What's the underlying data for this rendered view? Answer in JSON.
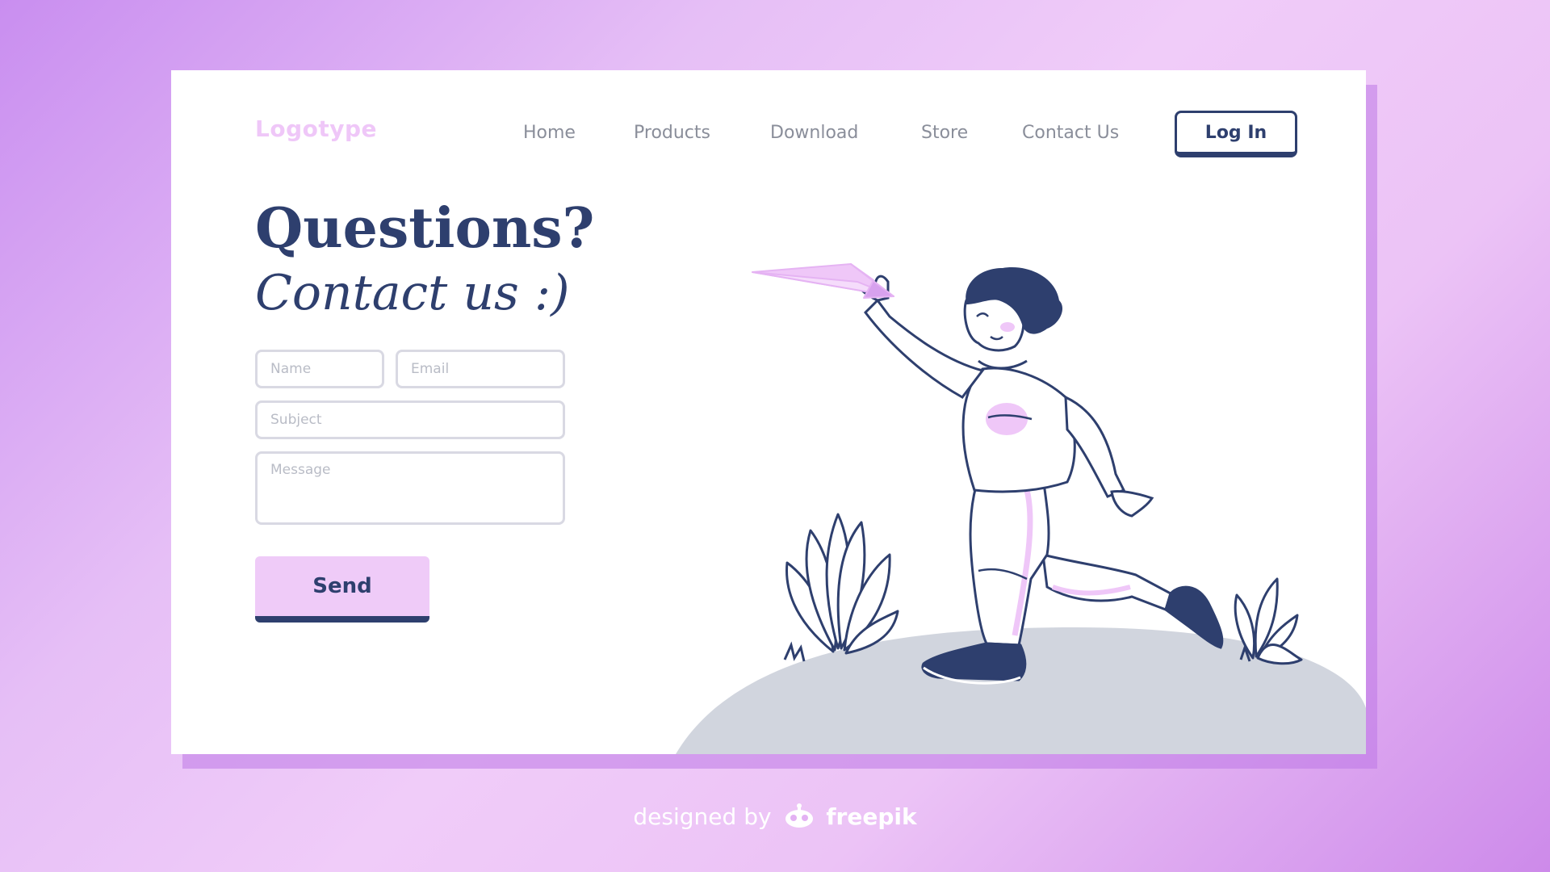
{
  "brand": {
    "logo_text": "Logotype"
  },
  "nav": {
    "items": [
      {
        "label": "Home"
      },
      {
        "label": "Products"
      },
      {
        "label": "Download"
      },
      {
        "label": "Store"
      },
      {
        "label": "Contact Us"
      }
    ],
    "login_label": "Log In"
  },
  "hero": {
    "headline": "Questions?",
    "subheadline": "Contact us :)"
  },
  "form": {
    "name_placeholder": "Name",
    "email_placeholder": "Email",
    "subject_placeholder": "Subject",
    "message_placeholder": "Message",
    "send_label": "Send"
  },
  "credit": {
    "prefix": "designed by",
    "brand": "freepik"
  },
  "colors": {
    "navy": "#2e3f6e",
    "lilac": "#efc7f8",
    "hill": "#d1d5de",
    "nav_text": "#8a8e9a"
  }
}
